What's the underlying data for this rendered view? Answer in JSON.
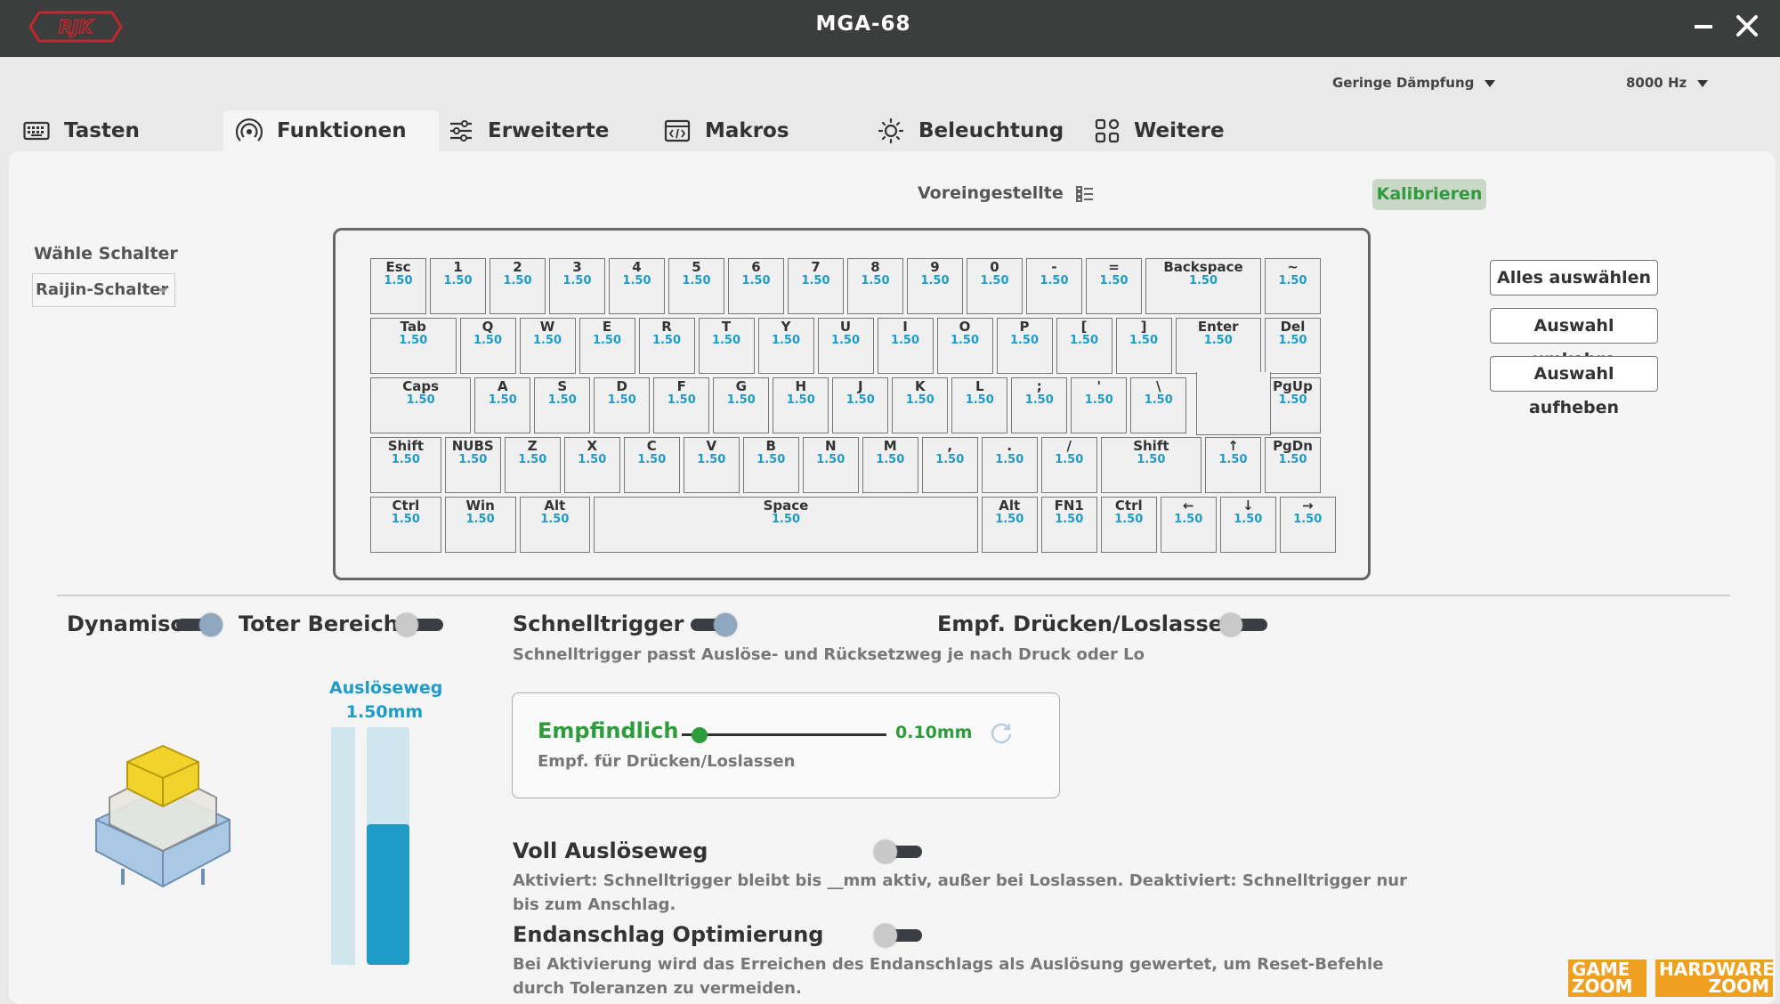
{
  "window": {
    "title": "MGA-68",
    "logo_text": "RJK"
  },
  "header": {
    "damping": "Geringe Dämpfung",
    "polling": "8000 Hz"
  },
  "tabs": [
    {
      "label": "Tasten",
      "icon": "keyboard-icon"
    },
    {
      "label": "Funktionen",
      "icon": "signal-icon",
      "active": true
    },
    {
      "label": "Erweiterte",
      "icon": "sliders-icon"
    },
    {
      "label": "Makros",
      "icon": "code-window-icon"
    },
    {
      "label": "Beleuchtung",
      "icon": "sun-icon"
    },
    {
      "label": "Weitere",
      "icon": "grid-icon"
    }
  ],
  "preset": {
    "label": "Voreingestellte",
    "calibrate": "Kalibrieren"
  },
  "switch_select": {
    "label": "Wähle Schalter",
    "value": "Raijin-Schalter"
  },
  "keyboard": {
    "rows": [
      [
        {
          "l": "Esc",
          "v": "1.50"
        },
        {
          "l": "1",
          "v": "1.50"
        },
        {
          "l": "2",
          "v": "1.50"
        },
        {
          "l": "3",
          "v": "1.50"
        },
        {
          "l": "4",
          "v": "1.50"
        },
        {
          "l": "5",
          "v": "1.50"
        },
        {
          "l": "6",
          "v": "1.50"
        },
        {
          "l": "7",
          "v": "1.50"
        },
        {
          "l": "8",
          "v": "1.50"
        },
        {
          "l": "9",
          "v": "1.50"
        },
        {
          "l": "0",
          "v": "1.50"
        },
        {
          "l": "-",
          "v": "1.50"
        },
        {
          "l": "=",
          "v": "1.50"
        },
        {
          "l": "Backspace",
          "v": "1.50"
        },
        {
          "l": "~",
          "v": "1.50"
        }
      ],
      [
        {
          "l": "Tab",
          "v": "1.50"
        },
        {
          "l": "Q",
          "v": "1.50"
        },
        {
          "l": "W",
          "v": "1.50"
        },
        {
          "l": "E",
          "v": "1.50"
        },
        {
          "l": "R",
          "v": "1.50"
        },
        {
          "l": "T",
          "v": "1.50"
        },
        {
          "l": "Y",
          "v": "1.50"
        },
        {
          "l": "U",
          "v": "1.50"
        },
        {
          "l": "I",
          "v": "1.50"
        },
        {
          "l": "O",
          "v": "1.50"
        },
        {
          "l": "P",
          "v": "1.50"
        },
        {
          "l": "[",
          "v": "1.50"
        },
        {
          "l": "]",
          "v": "1.50"
        },
        {
          "l": "Enter",
          "v": "1.50"
        },
        {
          "l": "Del",
          "v": "1.50"
        }
      ],
      [
        {
          "l": "Caps",
          "v": "1.50"
        },
        {
          "l": "A",
          "v": "1.50"
        },
        {
          "l": "S",
          "v": "1.50"
        },
        {
          "l": "D",
          "v": "1.50"
        },
        {
          "l": "F",
          "v": "1.50"
        },
        {
          "l": "G",
          "v": "1.50"
        },
        {
          "l": "H",
          "v": "1.50"
        },
        {
          "l": "J",
          "v": "1.50"
        },
        {
          "l": "K",
          "v": "1.50"
        },
        {
          "l": "L",
          "v": "1.50"
        },
        {
          "l": ";",
          "v": "1.50"
        },
        {
          "l": "'",
          "v": "1.50"
        },
        {
          "l": "\\",
          "v": "1.50"
        },
        {
          "l": "PgUp",
          "v": "1.50"
        }
      ],
      [
        {
          "l": "Shift",
          "v": "1.50"
        },
        {
          "l": "NUBS",
          "v": "1.50"
        },
        {
          "l": "Z",
          "v": "1.50"
        },
        {
          "l": "X",
          "v": "1.50"
        },
        {
          "l": "C",
          "v": "1.50"
        },
        {
          "l": "V",
          "v": "1.50"
        },
        {
          "l": "B",
          "v": "1.50"
        },
        {
          "l": "N",
          "v": "1.50"
        },
        {
          "l": "M",
          "v": "1.50"
        },
        {
          "l": ",",
          "v": "1.50"
        },
        {
          "l": ".",
          "v": "1.50"
        },
        {
          "l": "/",
          "v": "1.50"
        },
        {
          "l": "Shift",
          "v": "1.50"
        },
        {
          "l": "↑",
          "v": "1.50"
        },
        {
          "l": "PgDn",
          "v": "1.50"
        }
      ],
      [
        {
          "l": "Ctrl",
          "v": "1.50"
        },
        {
          "l": "Win",
          "v": "1.50"
        },
        {
          "l": "Alt",
          "v": "1.50"
        },
        {
          "l": "Space",
          "v": "1.50"
        },
        {
          "l": "Alt",
          "v": "1.50"
        },
        {
          "l": "FN1",
          "v": "1.50"
        },
        {
          "l": "Ctrl",
          "v": "1.50"
        },
        {
          "l": "←",
          "v": "1.50"
        },
        {
          "l": "↓",
          "v": "1.50"
        },
        {
          "l": "→",
          "v": "1.50"
        }
      ]
    ]
  },
  "selection_buttons": {
    "select_all": "Alles auswählen",
    "invert": "Auswahl umkehre",
    "clear": "Auswahl aufheben"
  },
  "toggles": {
    "dynamic": {
      "label": "Dynamisc",
      "on": true
    },
    "deadzone": {
      "label": "Toter Bereich",
      "on": false
    },
    "rapid_trigger": {
      "label": "Schnelltrigger",
      "on": true,
      "desc": "Schnelltrigger passt Auslöse- und Rücksetzweg je nach Druck oder Lo"
    },
    "sensitivity_press_release": {
      "label": "Empf. Drücken/Loslassen",
      "on": false
    },
    "full_travel": {
      "label": "Voll Auslöseweg",
      "on": false,
      "desc": "Aktiviert: Schnelltrigger bleibt bis __mm aktiv, außer bei Loslassen. Deaktiviert: Schnelltrigger nur bis zum Anschlag."
    },
    "bottom_out": {
      "label": "Endanschlag Optimierung",
      "on": false,
      "desc": "Bei Aktivierung wird das Erreichen des Endanschlags als Auslösung gewertet, um Reset-Befehle durch Toleranzen zu vermeiden."
    }
  },
  "actuation": {
    "label": "Auslöseweg",
    "value": "1.50mm",
    "fraction": 0.59
  },
  "sensitivity": {
    "title": "Empfindlich",
    "value": "0.10mm",
    "fraction": 0.05,
    "subtitle": "Empf. für Drücken/Loslassen"
  },
  "watermark": {
    "left_top": "GAME",
    "left_bottom": "ZOOM",
    "right_top": "HARDWARE",
    "right_bottom": "ZOOM"
  },
  "colors": {
    "accent_green": "#2e9b3d",
    "accent_blue": "#1e9cc7",
    "title_bar": "#3c3e3e"
  }
}
